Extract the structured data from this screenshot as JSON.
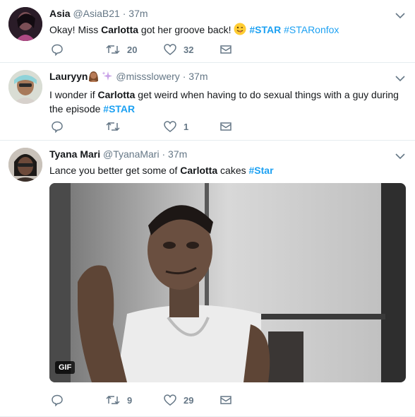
{
  "tweets": [
    {
      "name": "Asia",
      "handle": "@AsiaB21",
      "time": "37m",
      "text_parts": {
        "a": "Okay! Miss ",
        "b": "Carlotta",
        "c": " got her groove back! ",
        "tag1": "#STAR",
        "tag2": "#STARonfox"
      },
      "counts": {
        "reply": "",
        "retweet": "20",
        "like": "32"
      }
    },
    {
      "name": "Lauryyn",
      "handle": "@missslowery",
      "time": "37m",
      "text_parts": {
        "a": "I wonder if ",
        "b": "Carlotta",
        "c": " get weird when having to do sexual things with a guy during the episode ",
        "tag1": "#STAR"
      },
      "counts": {
        "reply": "",
        "retweet": "",
        "like": "1"
      }
    },
    {
      "name": "Tyana Mari",
      "handle": "@TyanaMari",
      "time": "37m",
      "text_parts": {
        "a": "Lance you better get some of ",
        "b": "Carlotta",
        "c": " cakes ",
        "tag1": "#Star"
      },
      "media_badge": "GIF",
      "counts": {
        "reply": "",
        "retweet": "9",
        "like": "29"
      }
    }
  ],
  "dot": "·",
  "icons": [
    "chevron-down-icon",
    "reply-icon",
    "retweet-icon",
    "like-icon",
    "message-icon"
  ],
  "colors": {
    "link": "#1da1f2",
    "muted": "#657786",
    "text": "#14171a",
    "divider": "#e6ecf0"
  }
}
